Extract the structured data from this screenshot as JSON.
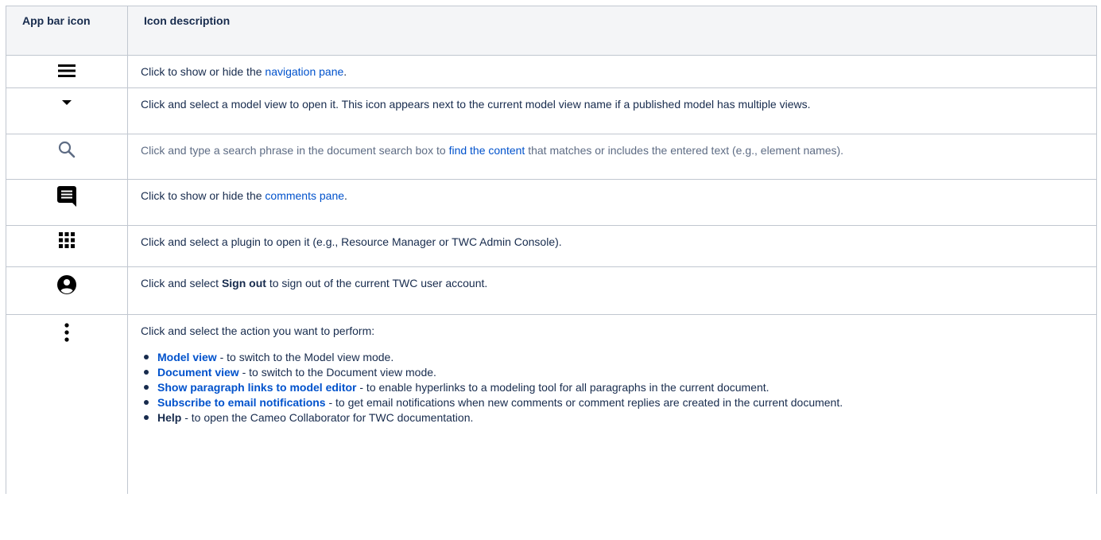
{
  "header": {
    "col1": "App bar icon",
    "col2": "Icon description"
  },
  "rows": [
    {
      "icon": "hamburger-menu-icon",
      "pre": "Click to show or hide the ",
      "link": "navigation pane",
      "post": "."
    },
    {
      "icon": "dropdown-arrow-icon",
      "text": "Click and select a model view to open it. This icon appears next to the current model view name if a published model has multiple views."
    },
    {
      "icon": "search-icon",
      "pre": "Click and type a search phrase in the document search box to ",
      "link": "find the content",
      "post": " that matches or includes the entered text (e.g., element names)."
    },
    {
      "icon": "comment-icon",
      "pre": "Click to show or hide the ",
      "link": "comments pane",
      "post": "."
    },
    {
      "icon": "apps-grid-icon",
      "text": "Click and select a plugin to open it (e.g., Resource Manager or TWC Admin Console)."
    },
    {
      "icon": "account-icon",
      "pre": "Click and select ",
      "bold": "Sign out",
      "post": " to sign out of the current TWC user account."
    },
    {
      "icon": "more-vertical-icon",
      "intro": "Click and select the action you want to perform:",
      "items": [
        {
          "label": "Model view",
          "rest": " - to switch to the Model view mode."
        },
        {
          "label": "Document view",
          "rest": " - to switch to the Document view mode."
        },
        {
          "label": "Show paragraph links to model editor",
          "rest": " - to enable hyperlinks to a modeling tool for all paragraphs in the current document."
        },
        {
          "label": "Subscribe to email notifications",
          "rest": " - to get email notifications when new comments or comment replies are created in the current document."
        },
        {
          "label": "Help",
          "rest": " - to open the Cameo Collaborator for TWC documentation."
        }
      ]
    }
  ],
  "colors": {
    "link": "#0052cc",
    "border": "#c1c7d0",
    "header_bg": "#f4f5f7",
    "icon": "#000000"
  }
}
